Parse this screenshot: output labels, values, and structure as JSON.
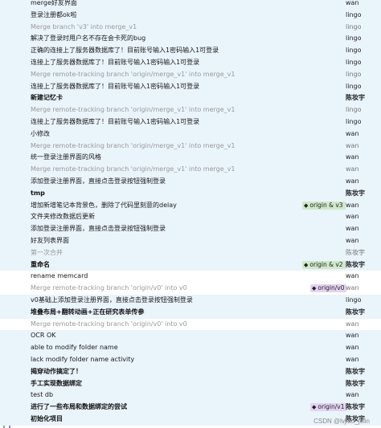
{
  "commits": [
    {
      "message": "merge好友界面",
      "author": "wan",
      "kind": "normal"
    },
    {
      "message": "登录注册都ok啦",
      "author": "lingo",
      "kind": "normal"
    },
    {
      "message": "Merge branch 'v3' into merge_v1",
      "author": "lingo",
      "kind": "merge"
    },
    {
      "message": "解决了登录时用户名不存在会卡死的bug",
      "author": "lingo",
      "kind": "normal"
    },
    {
      "message": "正确的连接上了服务器数据库了！目前账号输入1密码输入1可登录",
      "author": "lingo",
      "kind": "normal"
    },
    {
      "message": "连接上了服务器数据库了！目前账号输入1密码输入1可登录",
      "author": "lingo",
      "kind": "normal"
    },
    {
      "message": "Merge remote-tracking branch 'origin/merge_v1' into merge_v1",
      "author": "lingo",
      "kind": "merge"
    },
    {
      "message": "连接上了服务器数据库了！目前账号输入1密码输入1可登录",
      "author": "lingo",
      "kind": "normal"
    },
    {
      "message": "新建记忆卡",
      "author": "陈妆宇",
      "kind": "bold"
    },
    {
      "message": "Merge remote-tracking branch 'origin/merge_v1' into merge_v1",
      "author": "lingo",
      "kind": "merge"
    },
    {
      "message": "连接上了服务器数据库了！目前账号输入1密码输入1可登录",
      "author": "lingo",
      "kind": "normal"
    },
    {
      "message": "小修改",
      "author": "wan",
      "kind": "normal"
    },
    {
      "message": "Merge remote-tracking branch 'origin/merge_v1' into merge_v1",
      "author": "wan",
      "kind": "merge"
    },
    {
      "message": "统一登录注册界面的风格",
      "author": "wan",
      "kind": "normal"
    },
    {
      "message": "Merge remote-tracking branch 'origin/merge_v1' into merge_v1",
      "author": "wan",
      "kind": "merge"
    },
    {
      "message": "添加登录注册界面，直接点击登录按钮强制登录",
      "author": "wan",
      "kind": "normal"
    },
    {
      "message": "tmp",
      "author": "陈妆宇",
      "kind": "bold"
    },
    {
      "message": "增加新增笔记本背景色，删除了代码里刻意的delay",
      "author": "wan",
      "kind": "normal",
      "tag": "origin & v3",
      "tag_color": "green"
    },
    {
      "message": "文件夹修改数据后更新",
      "author": "wan",
      "kind": "normal"
    },
    {
      "message": "添加登录注册界面，直接点击登录按钮强制登录",
      "author": "wan",
      "kind": "normal"
    },
    {
      "message": "好友列表界面",
      "author": "wan",
      "kind": "normal"
    },
    {
      "message": "第一次合并",
      "author": "陈妆宇",
      "kind": "merge"
    },
    {
      "message": "重命名",
      "author": "陈妆宇",
      "kind": "bold",
      "tag": "origin & v2",
      "tag_color": "green"
    },
    {
      "message": "rename memcard",
      "author": "wan",
      "kind": "normal"
    },
    {
      "message": "Merge remote-tracking branch 'origin/v0' into v0",
      "author": "wan",
      "kind": "merge",
      "tag": "origin/v0",
      "tag_color": "purple"
    },
    {
      "message": "v0基础上添加登录注册界面，直接点击登录按钮强制登录",
      "author": "lingo",
      "kind": "normal"
    },
    {
      "message": "堆叠布局+翻转动画+正在研究表单传参",
      "author": "陈妆宇",
      "kind": "bold"
    },
    {
      "message": "Merge remote-tracking branch 'origin/v0' into v0",
      "author": "wan",
      "kind": "merge"
    },
    {
      "message": "OCR OK",
      "author": "wan",
      "kind": "normal"
    },
    {
      "message": "able to modify folder name",
      "author": "wan",
      "kind": "normal"
    },
    {
      "message": "lack modify folder name activity",
      "author": "wan",
      "kind": "normal"
    },
    {
      "message": "揭穿动作搞定了！",
      "author": "陈妆宇",
      "kind": "bold"
    },
    {
      "message": "手工实现数据绑定",
      "author": "陈妆宇",
      "kind": "bold"
    },
    {
      "message": "test db",
      "author": "wan",
      "kind": "normal"
    },
    {
      "message": "进行了一些布局和数据绑定的尝试",
      "author": "陈妆宇",
      "kind": "bold",
      "tag": "origin/v1",
      "tag_color": "purple"
    },
    {
      "message": "初始化项目",
      "author": "陈妆宇",
      "kind": "bold"
    }
  ],
  "colors": {
    "lane_main": "#4f7b3a",
    "lane_blue": "#5f9fc7",
    "lane_purple": "#5a3f8c",
    "lane_gray": "#8a8a8a"
  },
  "watermark": "CSDN @lvjiao_jolin"
}
